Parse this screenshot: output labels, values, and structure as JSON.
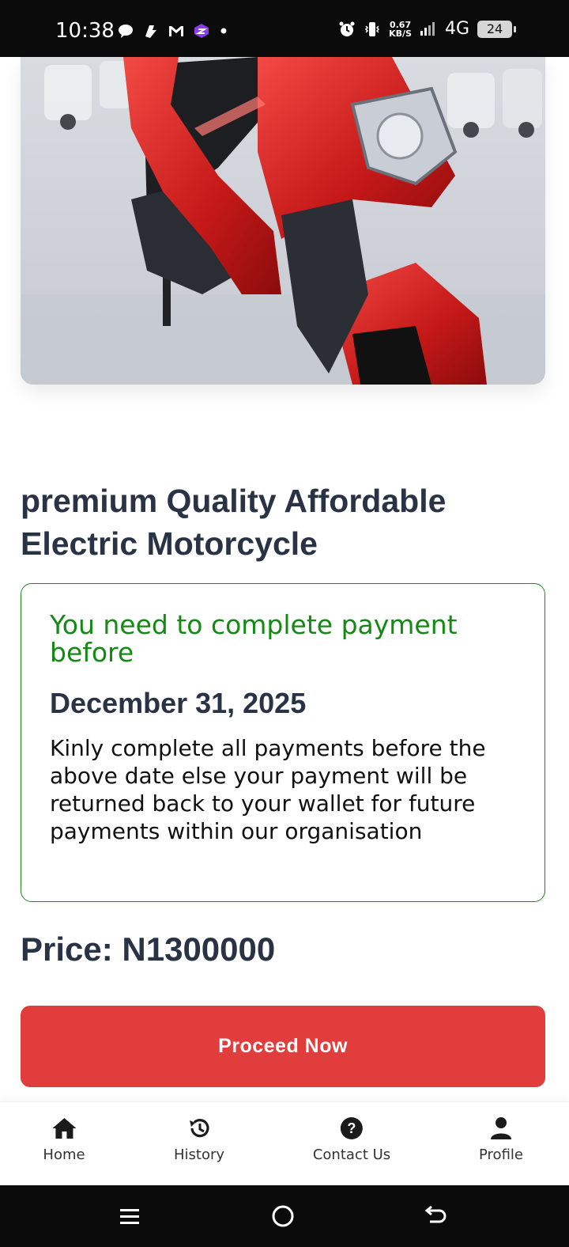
{
  "status_bar": {
    "time": "10:38",
    "speed_value": "0.67",
    "speed_unit": "KB/S",
    "network": "4G",
    "battery": "24",
    "left_icons": [
      "chat-bubble-icon",
      "app-icon",
      "gmail-icon",
      "app-purple-icon",
      "dot-icon"
    ],
    "right_icons": [
      "alarm-icon",
      "vibrate-icon",
      "signal-icon"
    ]
  },
  "product": {
    "image": "red-electric-scooter-photo",
    "title": "premium Quality Affordable Electric Motorcycle"
  },
  "notice": {
    "heading": "You need to complete payment before",
    "deadline": "December 31, 2025",
    "body": "Kinly complete all payments before the above date else your payment will be returned back to your wallet for future payments within our organisation"
  },
  "price": {
    "label": "Price: N1300000"
  },
  "actions": {
    "proceed_label": "Proceed Now"
  },
  "bottom_nav": {
    "items": [
      {
        "label": "Home",
        "icon": "home-icon"
      },
      {
        "label": "History",
        "icon": "history-icon"
      },
      {
        "label": "Contact Us",
        "icon": "help-icon"
      },
      {
        "label": "Profile",
        "icon": "person-icon"
      }
    ]
  },
  "colors": {
    "accent_red": "#e23d3d",
    "notice_green": "#138a13",
    "title_navy": "#2a3346"
  }
}
